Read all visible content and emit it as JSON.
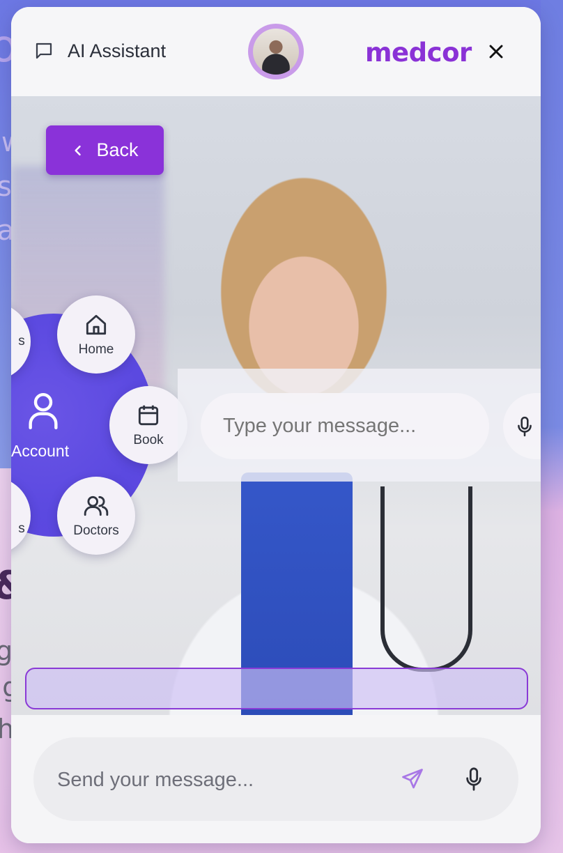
{
  "header": {
    "title": "AI Assistant",
    "brand": "medcor"
  },
  "video": {
    "back_label": "Back"
  },
  "radial_menu": {
    "hub_label": "Account",
    "items": {
      "home": "Home",
      "book": "Book",
      "doctors": "Doctors",
      "partial_top": "s",
      "partial_bottom": "s"
    }
  },
  "overlay": {
    "placeholder": "Type your message..."
  },
  "footer": {
    "placeholder": "Send your message..."
  },
  "background_fragments": {
    "letter_o": "o",
    "letter_w": "w",
    "letter_s": "s",
    "letter_a": "a",
    "ampersand": "&",
    "letter_g": "g",
    "letters_ag": "ag",
    "letter_h": "h"
  },
  "colors": {
    "accent": "#8a32d6",
    "hub": "#5b49e0"
  }
}
